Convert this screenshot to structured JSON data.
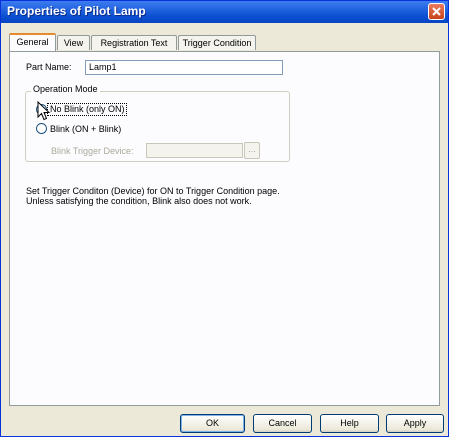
{
  "window": {
    "title": "Properties of Pilot Lamp"
  },
  "tabs": [
    {
      "label": "General",
      "active": true
    },
    {
      "label": "View",
      "active": false
    },
    {
      "label": "Registration Text",
      "active": false
    },
    {
      "label": "Trigger Condition",
      "active": false
    }
  ],
  "general": {
    "part_name_label": "Part Name:",
    "part_name_value": "Lamp1",
    "operation_mode": {
      "legend": "Operation Mode",
      "options": [
        {
          "label": "No Blink (only ON)",
          "selected": true
        },
        {
          "label": "Blink (ON + Blink)",
          "selected": false
        }
      ],
      "blink_trigger_label": "Blink Trigger Device:",
      "blink_trigger_value": "",
      "browse_label": "..."
    },
    "info_line_1": "Set Trigger Conditon (Device) for ON to Trigger Condition page.",
    "info_line_2": "Unless satisfying the condition, Blink also does not work."
  },
  "buttons": {
    "ok": "OK",
    "cancel": "Cancel",
    "help": "Help",
    "apply": "Apply"
  },
  "colors": {
    "titlebar": "#0a4fd0",
    "dialog_bg": "#ece9d8",
    "tab_highlight": "#e68b2c",
    "radio_dot": "#21a121"
  }
}
